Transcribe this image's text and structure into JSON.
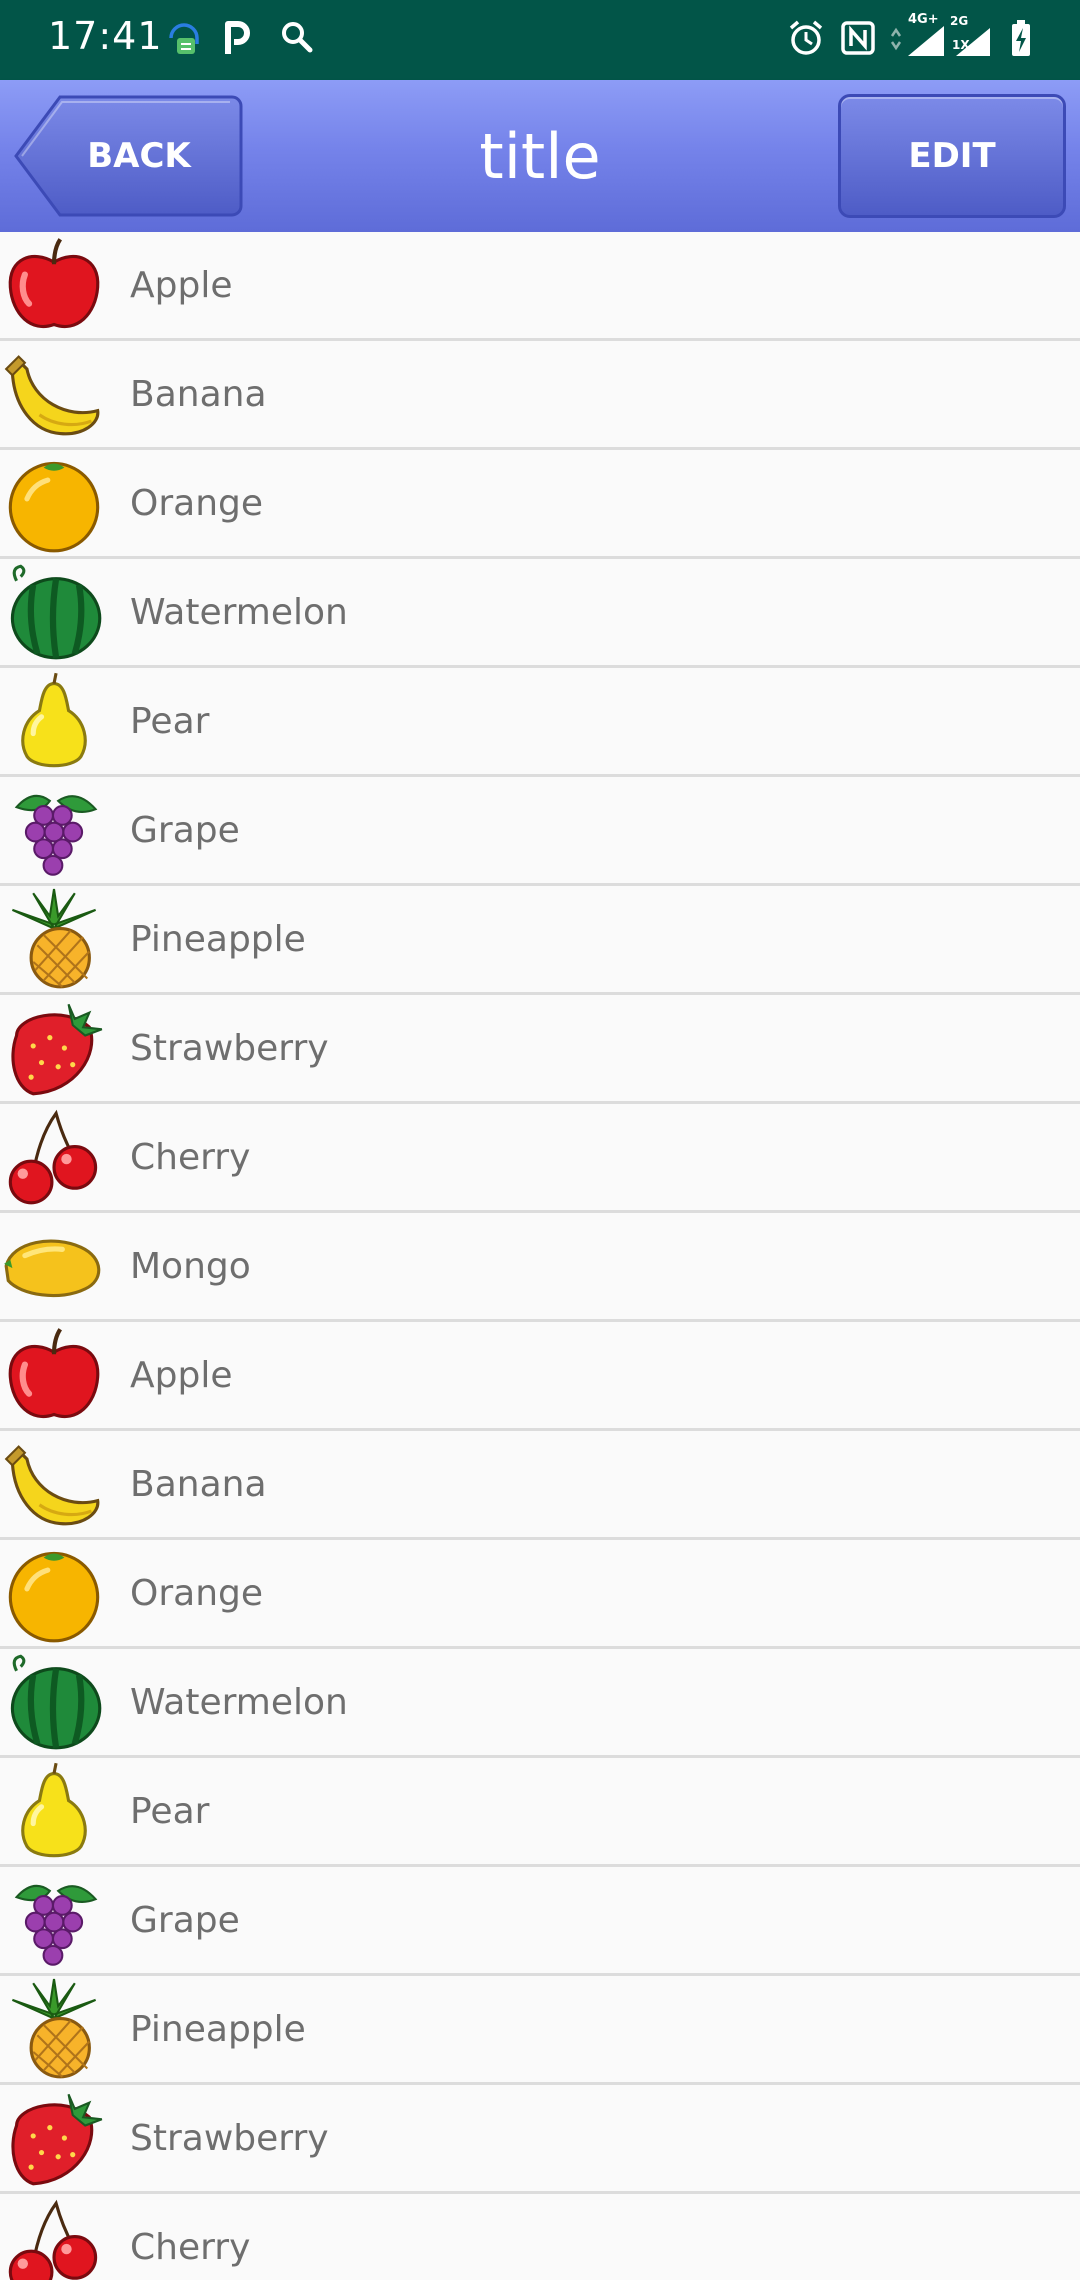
{
  "status_bar": {
    "time": "17:41",
    "left_icons": [
      "assistant-icon",
      "p-app-icon",
      "search-icon"
    ],
    "right_icons": [
      "alarm-icon",
      "nfc-icon",
      "data-arrows-icon",
      "signal-4g-icon",
      "signal-2g-icon",
      "battery-charging-icon"
    ],
    "network_primary": "4G+",
    "network_secondary": "2G",
    "network_secondary_sub": "1X"
  },
  "app_bar": {
    "back_label": "BACK",
    "title": "title",
    "edit_label": "EDIT",
    "color": "#7583ea"
  },
  "fruits": [
    {
      "name": "Apple",
      "icon": "apple-icon"
    },
    {
      "name": "Banana",
      "icon": "banana-icon"
    },
    {
      "name": "Orange",
      "icon": "orange-icon"
    },
    {
      "name": "Watermelon",
      "icon": "watermelon-icon"
    },
    {
      "name": "Pear",
      "icon": "pear-icon"
    },
    {
      "name": "Grape",
      "icon": "grape-icon"
    },
    {
      "name": "Pineapple",
      "icon": "pineapple-icon"
    },
    {
      "name": "Strawberry",
      "icon": "strawberry-icon"
    },
    {
      "name": "Cherry",
      "icon": "cherry-icon"
    },
    {
      "name": "Mongo",
      "icon": "mango-icon"
    },
    {
      "name": "Apple",
      "icon": "apple-icon"
    },
    {
      "name": "Banana",
      "icon": "banana-icon"
    },
    {
      "name": "Orange",
      "icon": "orange-icon"
    },
    {
      "name": "Watermelon",
      "icon": "watermelon-icon"
    },
    {
      "name": "Pear",
      "icon": "pear-icon"
    },
    {
      "name": "Grape",
      "icon": "grape-icon"
    },
    {
      "name": "Pineapple",
      "icon": "pineapple-icon"
    },
    {
      "name": "Strawberry",
      "icon": "strawberry-icon"
    },
    {
      "name": "Cherry",
      "icon": "cherry-icon"
    }
  ]
}
